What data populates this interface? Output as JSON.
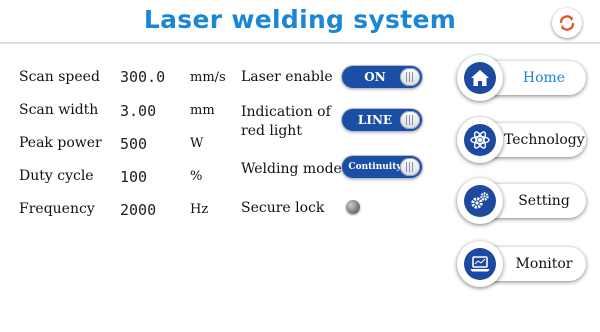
{
  "header": {
    "title": "Laser welding system",
    "refresh_icon": "refresh-icon"
  },
  "params": [
    {
      "label": "Scan speed",
      "value": "300.0",
      "unit": "mm/s"
    },
    {
      "label": "Scan width",
      "value": "3.00",
      "unit": "mm"
    },
    {
      "label": "Peak power",
      "value": "500",
      "unit": "W"
    },
    {
      "label": "Duty cycle",
      "value": "100",
      "unit": "%"
    },
    {
      "label": "Frequency",
      "value": "2000",
      "unit": "Hz"
    }
  ],
  "controls": {
    "laser_enable": {
      "label": "Laser enable",
      "state": "ON"
    },
    "red_light": {
      "label_line1": "Indication of",
      "label_line2": "red light",
      "state": "LINE"
    },
    "welding_mode": {
      "label": "Welding mode",
      "state": "Continuity"
    },
    "secure_lock": {
      "label": "Secure lock",
      "status": "off"
    }
  },
  "nav": [
    {
      "label": "Home",
      "icon": "home-icon",
      "active": true
    },
    {
      "label": "Technology",
      "icon": "atom-icon",
      "active": false
    },
    {
      "label": "Setting",
      "icon": "gears-icon",
      "active": false
    },
    {
      "label": "Monitor",
      "icon": "laptop-icon",
      "active": false
    }
  ],
  "colors": {
    "accent": "#1c86d6",
    "toggle_bg": "#1b4fa6",
    "icon_bg": "#1d4a9e"
  }
}
